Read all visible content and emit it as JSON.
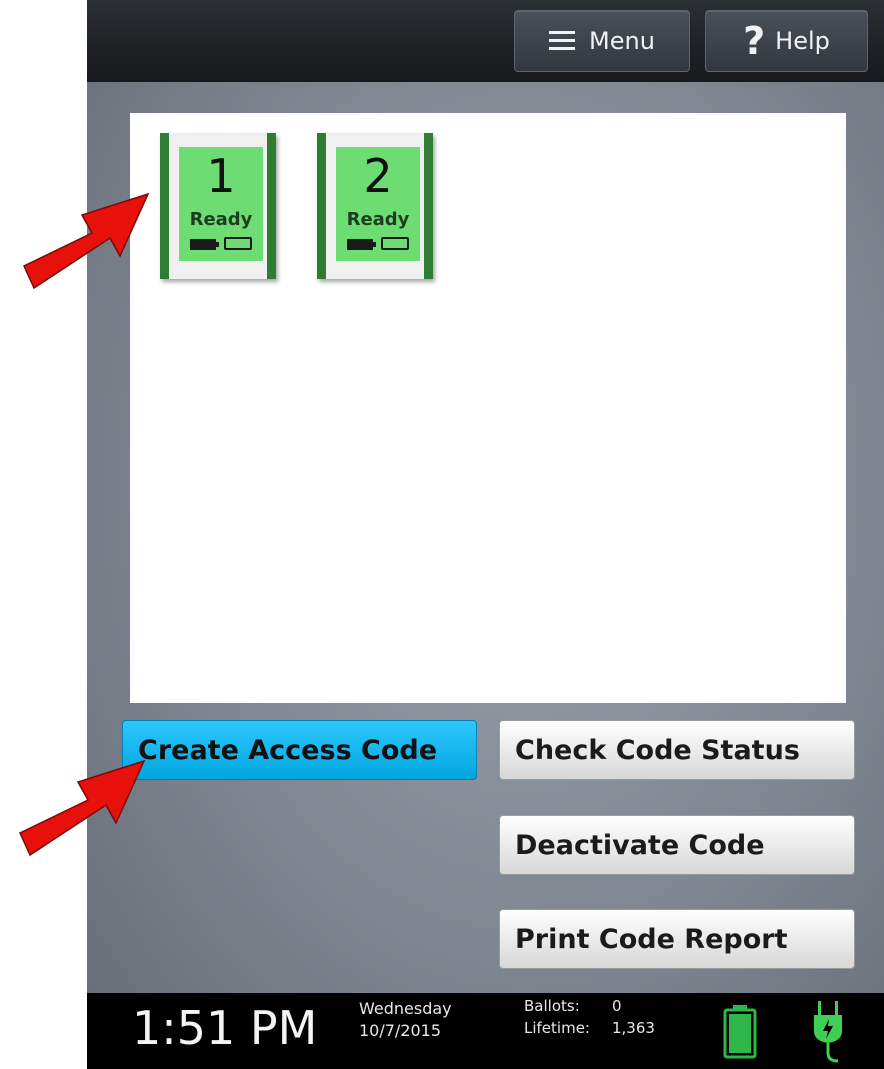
{
  "header": {
    "menu_label": "Menu",
    "help_label": "Help",
    "help_glyph": "?"
  },
  "tablets": [
    {
      "number": "1",
      "status": "Ready"
    },
    {
      "number": "2",
      "status": "Ready"
    }
  ],
  "actions": {
    "create": "Create Access Code",
    "check": "Check Code Status",
    "deactivate": "Deactivate Code",
    "print": "Print Code Report"
  },
  "status_bar": {
    "time": "1:51 PM",
    "day": "Wednesday",
    "date": "10/7/2015",
    "ballots_label": "Ballots:",
    "ballots_value": "0",
    "lifetime_label": "Lifetime:",
    "lifetime_value": "1,363"
  },
  "colors": {
    "accent": "#00a6df",
    "tablet_ready": "#6ddc72",
    "tablet_edge": "#2e7d32",
    "arrow": "#e8100b",
    "battery": "#2fb84a",
    "plug": "#3fcf55"
  },
  "icons": [
    "hamburger-icon",
    "help-icon",
    "battery-icon",
    "power-plug-icon",
    "red-arrow-icon"
  ]
}
